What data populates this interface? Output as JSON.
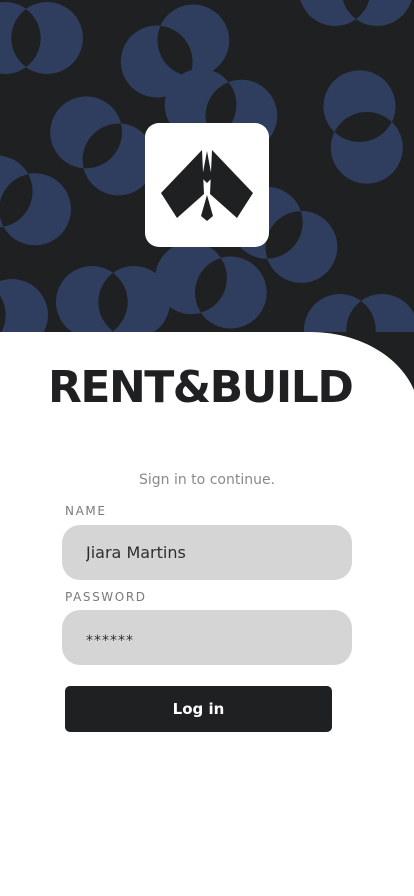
{
  "app": {
    "brand_name": "RENT&BUILD",
    "logo_icon": "folded-paper-arrow-icon"
  },
  "form": {
    "subtitle": "Sign in to continue.",
    "name_label": "NAME",
    "name_value": "Jiara Martins",
    "password_label": "PASSWORD",
    "password_value": "******",
    "login_label": "Log in"
  },
  "colors": {
    "hero_background": "#1e2021",
    "circle_accent": "#2f3e5e",
    "field_background": "#d5d5d5",
    "button_background": "#1e2021",
    "button_text": "#ffffff"
  }
}
